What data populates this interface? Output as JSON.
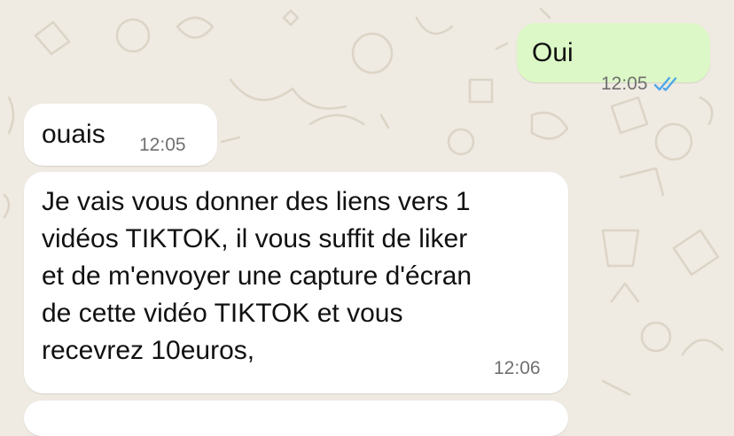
{
  "colors": {
    "wallpaper": "#efeae2",
    "outgoing_bubble": "#dcf8c6",
    "incoming_bubble": "#ffffff",
    "read_ticks": "#4fa6e8",
    "timestamp": "#707070"
  },
  "messages": [
    {
      "direction": "outgoing",
      "text": "Oui",
      "time": "12:05",
      "status_icon": "double-check-read-icon"
    },
    {
      "direction": "incoming",
      "text": "ouais",
      "time": "12:05"
    },
    {
      "direction": "incoming",
      "text": "Je vais vous donner des liens vers 1\nvidéos TIKTOK, il vous suffit de liker\net de m'envoyer une capture d'écran\nde cette vidéo TIKTOK et vous\nrecevrez 10euros,",
      "time": "12:06"
    }
  ]
}
